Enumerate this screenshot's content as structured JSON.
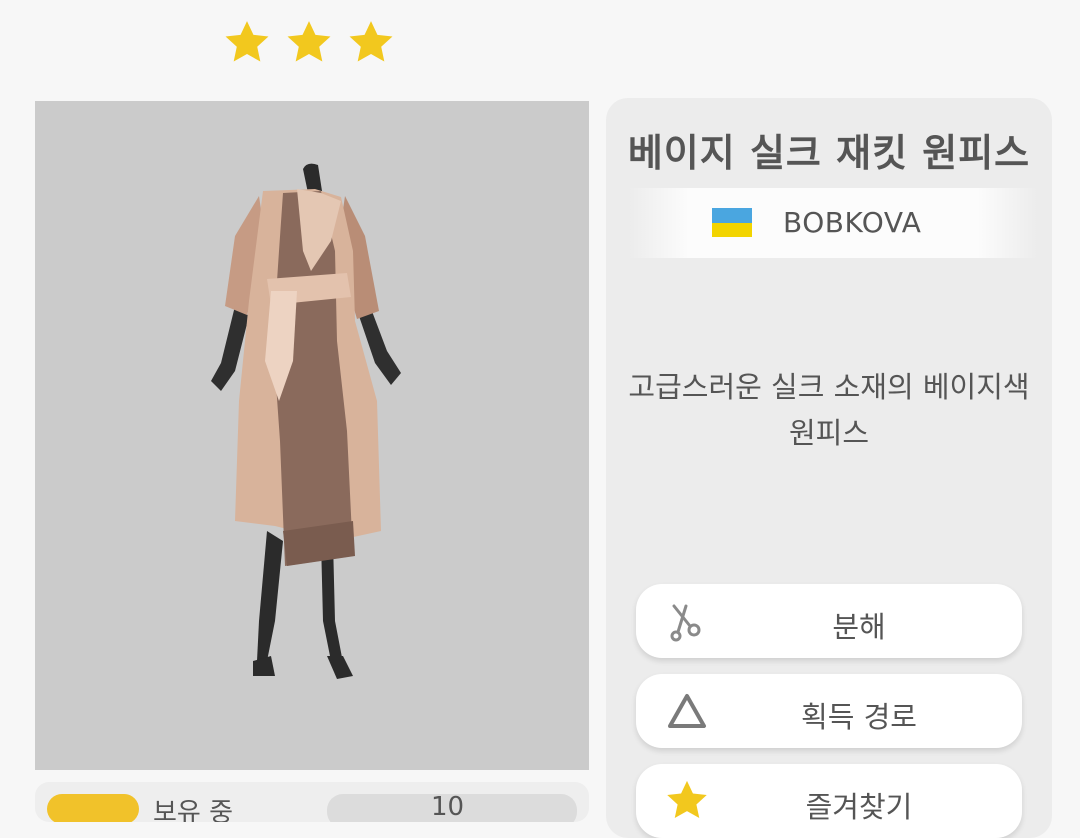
{
  "rating": {
    "stars": 3,
    "star_color": "#f2c81e"
  },
  "item": {
    "name": "베이지 실크 재킷 원피스",
    "designer_name": "BOBKOVA",
    "designer_flag": "ukraine-flag",
    "description_line1": "고급스러운 실크 소재의 베이지색",
    "description_line2": "원피스"
  },
  "actions": {
    "disassemble": {
      "label": "분해",
      "icon": "scissors-icon"
    },
    "acquire": {
      "label": "획득 경로",
      "icon": "triangle-icon"
    },
    "favorite": {
      "label": "즐겨찾기",
      "icon": "star-icon"
    }
  },
  "inventory": {
    "label": "보유 중",
    "count": "10"
  },
  "colors": {
    "preview_bg": "#cbcbcb",
    "panel_bg": "#ececec",
    "accent_yellow": "#f2c81e"
  }
}
